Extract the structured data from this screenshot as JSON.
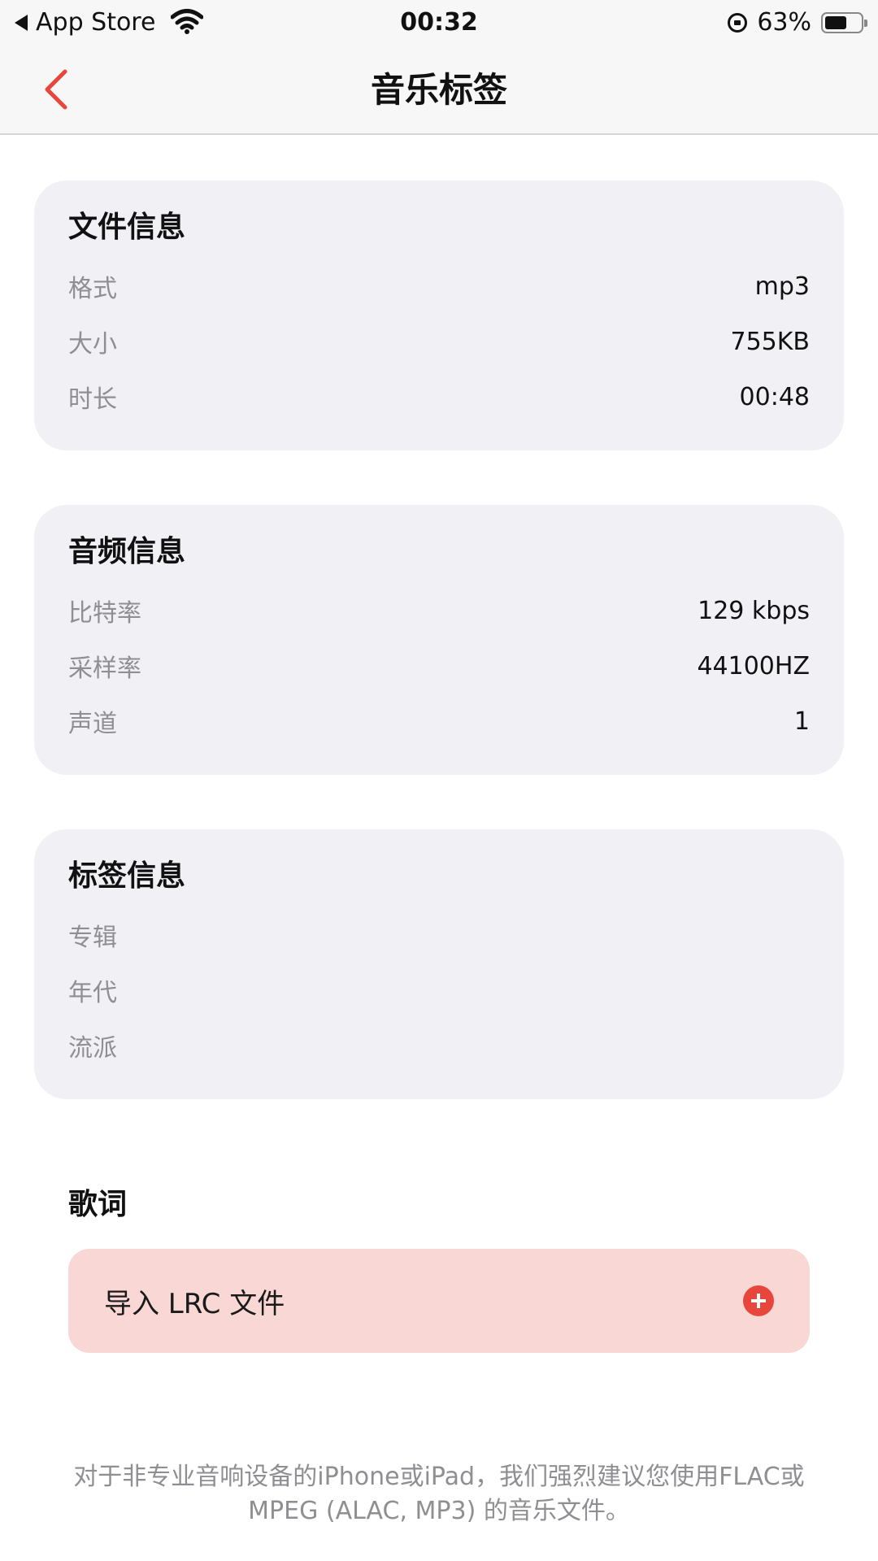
{
  "status_bar": {
    "back_app": "App Store",
    "time": "00:32",
    "battery": "63%",
    "battery_level": 0.63
  },
  "nav": {
    "title": "音乐标签"
  },
  "file_info": {
    "title": "文件信息",
    "rows": [
      {
        "label": "格式",
        "value": "mp3"
      },
      {
        "label": "大小",
        "value": "755KB"
      },
      {
        "label": "时长",
        "value": "00:48"
      }
    ]
  },
  "audio_info": {
    "title": "音频信息",
    "rows": [
      {
        "label": "比特率",
        "value": "129 kbps"
      },
      {
        "label": "采样率",
        "value": "44100HZ"
      },
      {
        "label": "声道",
        "value": "1"
      }
    ]
  },
  "tag_info": {
    "title": "标签信息",
    "rows": [
      {
        "label": "专辑",
        "value": ""
      },
      {
        "label": "年代",
        "value": ""
      },
      {
        "label": "流派",
        "value": ""
      }
    ]
  },
  "lyrics": {
    "title": "歌词",
    "import_label": "导入 LRC 文件"
  },
  "footnote": {
    "line1": "对于非专业音响设备的iPhone或iPad，我们强烈建议您使用FLAC或",
    "line2": "MPEG (ALAC, MP3) 的音乐文件。"
  },
  "colors": {
    "accent": "#e8453c",
    "import_bg": "#f8d7d5",
    "card_bg": "#f1f1f5"
  }
}
